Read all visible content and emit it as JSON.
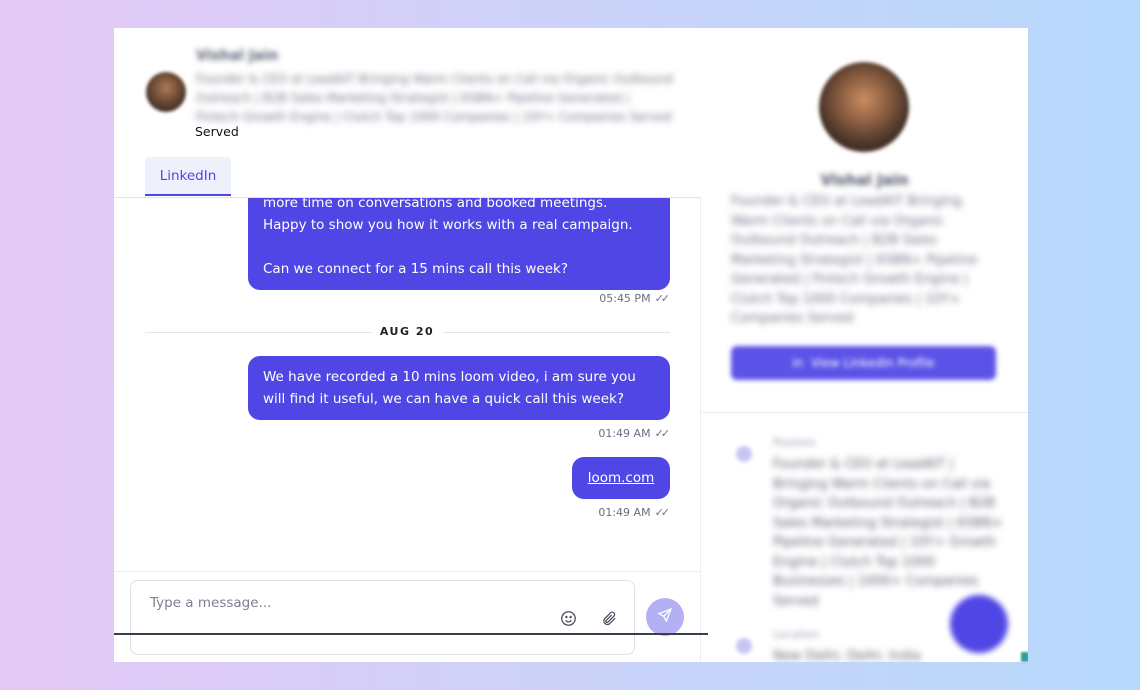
{
  "contact": {
    "name": "Vishal Jain",
    "headline": "Founder & CEO at LeadAIT Bringing Warm Clients on Call via Organic Outbound Outreach | B2B Sales Marketing Strategist | 65BN+ Pipeline Generated | Fintech Growth Engine | Clutch Top 1000 Companies | 10Y+ Companies Served",
    "status": "Served",
    "view_profile_label": "View LinkedIn Profile"
  },
  "tabs": [
    {
      "label": "LinkedIn"
    }
  ],
  "messages": [
    {
      "text": "more time on conversations and booked meetings.\nHappy to show you how it works with a real campaign.\n\nCan we connect for a 15 mins call this week?",
      "time": "05:45 PM"
    },
    {
      "text": "We have recorded a 10 mins loom video, i am sure you will find it useful, we can have a quick call this week?",
      "time": "01:49 AM"
    },
    {
      "text": "loom.com",
      "time": "01:49 AM"
    }
  ],
  "date_separator": "AUG 20",
  "composer": {
    "placeholder": "Type a message..."
  },
  "icons": {
    "emoji": "smiley-icon",
    "attach": "paperclip-icon",
    "send": "send-icon"
  },
  "profile_info": [
    {
      "label": "Position",
      "value": "Founder & CEO at LeadAIT | Bringing Warm Clients on Call via Organic Outbound Outreach | B2B Sales Marketing Strategist | 65BN+ Pipeline Generated | 10Y+ Growth Engine | Clutch Top 1000 Businesses | 1000+ Companies Served"
    },
    {
      "label": "Location",
      "value": "New Delhi, Delhi, India"
    }
  ],
  "colors": {
    "accent": "#4f46e5",
    "send_disabled": "#b3b0f6"
  }
}
